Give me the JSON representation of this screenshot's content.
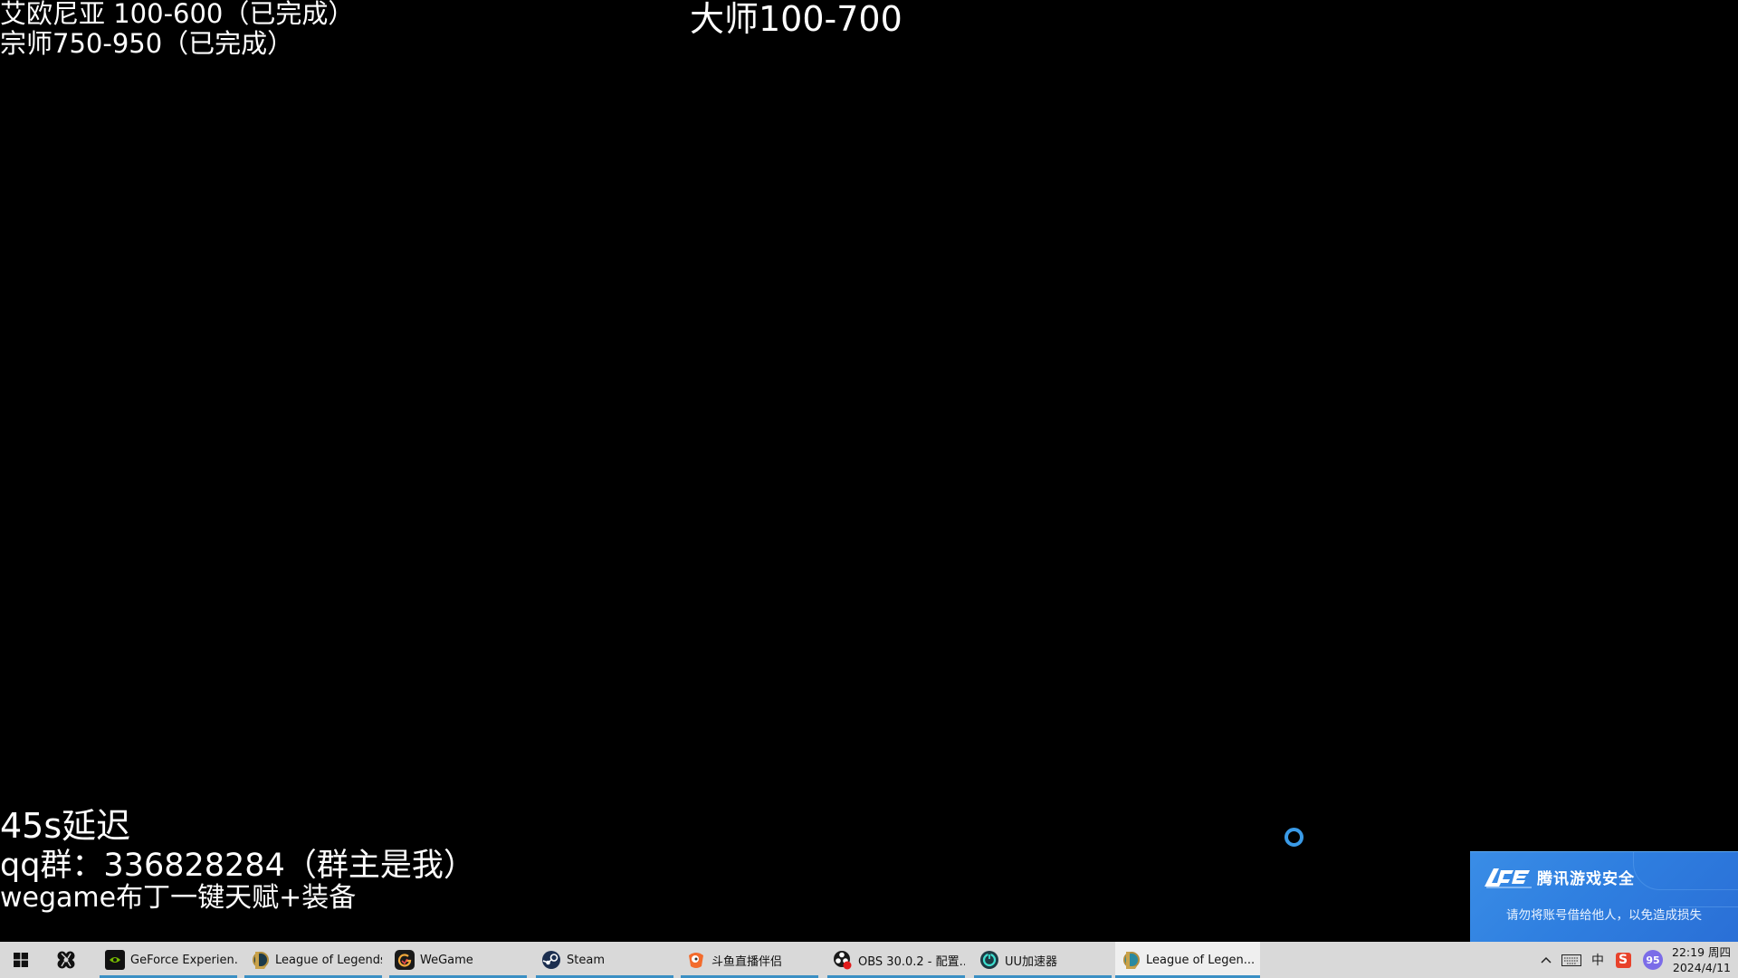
{
  "overlay": {
    "top_left_line1": "艾欧尼亚 100-600（已完成）",
    "top_left_line2": "宗师750-950（已完成）",
    "top_center": "大师100-700",
    "bottom_left_line1": "45s延迟",
    "bottom_left_line2": "qq群：336828284（群主是我）",
    "bottom_left_line3": "wegame布丁一键天赋+装备"
  },
  "toast": {
    "title": "腾讯游戏安全",
    "message": "请勿将账号借给他人，以免造成损失",
    "logo_icon": "ace-logo-icon",
    "background_color": "#2f7fe0"
  },
  "taskbar": {
    "start_icon": "windows-start-icon",
    "pinned_icon": "fan-app-icon",
    "tasks": [
      {
        "label": "GeForce Experien...",
        "icon": "nvidia-icon",
        "active": false
      },
      {
        "label": "League of Legends",
        "icon": "league-of-legends-icon",
        "active": false
      },
      {
        "label": "WeGame",
        "icon": "wegame-icon",
        "active": false
      },
      {
        "label": "Steam",
        "icon": "steam-icon",
        "active": false
      },
      {
        "label": "斗鱼直播伴侣",
        "icon": "douyu-icon",
        "active": false
      },
      {
        "label": "OBS 30.0.2 - 配置...",
        "icon": "obs-icon",
        "active": false
      },
      {
        "label": "UU加速器",
        "icon": "uu-accelerator-icon",
        "active": false
      },
      {
        "label": "League of Legen...",
        "icon": "league-of-legends-icon",
        "active": true
      }
    ],
    "tray": {
      "chevron": "^",
      "ime": "中",
      "sogou": "S",
      "badge": "95"
    },
    "clock": {
      "time": "22:19 周四",
      "date": "2024/4/11"
    },
    "accent_color": "#3a8fc4"
  }
}
